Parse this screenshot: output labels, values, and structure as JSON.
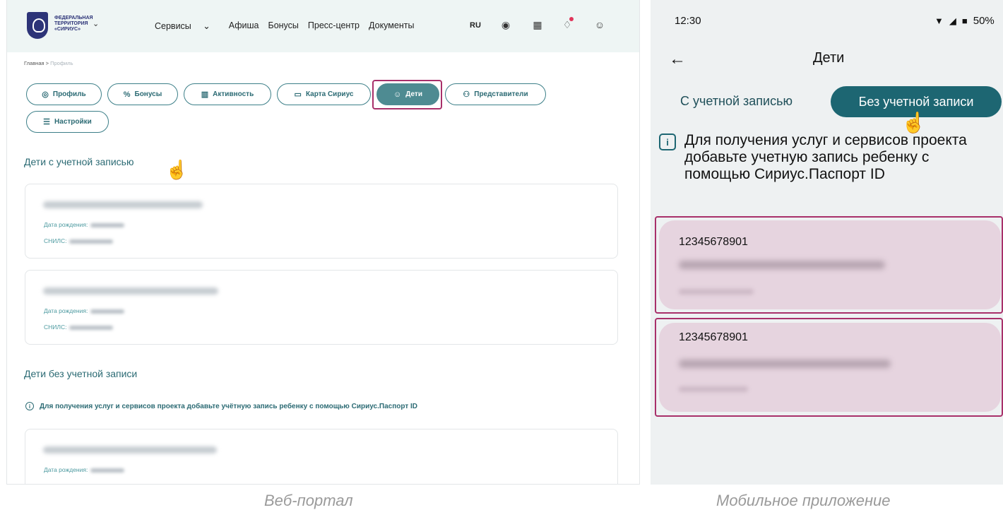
{
  "web": {
    "logo_text": "ФЕДЕРАЛЬНАЯ\nТЕРРИТОРИЯ\n«СИРИУС»",
    "nav": [
      {
        "label": "Сервисы",
        "has_dropdown": true
      },
      {
        "label": "Афиша"
      },
      {
        "label": "Бонусы"
      },
      {
        "label": "Пресс-центр"
      },
      {
        "label": "Документы"
      }
    ],
    "lang": "RU",
    "header_icons": [
      "eye-icon",
      "qr-icon",
      "bell-icon",
      "user-icon"
    ],
    "breadcrumbs": {
      "home": "Главная",
      "separator": ">",
      "current": "Профиль"
    },
    "tabs": [
      {
        "label": "Профиль",
        "icon": "user-circle-icon"
      },
      {
        "label": "Бонусы",
        "icon": "bonus-icon"
      },
      {
        "label": "Активность",
        "icon": "activity-icon"
      },
      {
        "label": "Карта Сириус",
        "icon": "card-icon"
      },
      {
        "label": "Дети",
        "icon": "child-face-icon",
        "active": true
      },
      {
        "label": "Представители",
        "icon": "people-icon"
      },
      {
        "label": "Настройки",
        "icon": "sliders-icon"
      }
    ],
    "with_account_title": "Дети с учетной записью",
    "birth_label": "Дата рождения:",
    "snils_label": "СНИЛС:",
    "without_account_title": "Дети без учетной записи",
    "notice": "Для получения услуг и сервисов проекта добавьте учётную запись ребенку с помощью Сириус.Паспорт ID"
  },
  "captions": {
    "web": "Веб-портал",
    "mobile": "Мобильное приложение"
  },
  "mobile": {
    "time": "12:30",
    "battery": "50%",
    "title": "Дети",
    "tab_with": "С учетной записью",
    "tab_without": "Без учетной записи",
    "info": "Для получения услуг и сервисов проекта добавьте учетную запись ребенку с помощью Сириус.Паспорт ID",
    "cards": [
      {
        "number": "12345678901"
      },
      {
        "number": "12345678901"
      }
    ]
  },
  "colors": {
    "accent": "#2c6b74",
    "highlight": "#a8306a",
    "mobile_card": "#e6d4df"
  }
}
